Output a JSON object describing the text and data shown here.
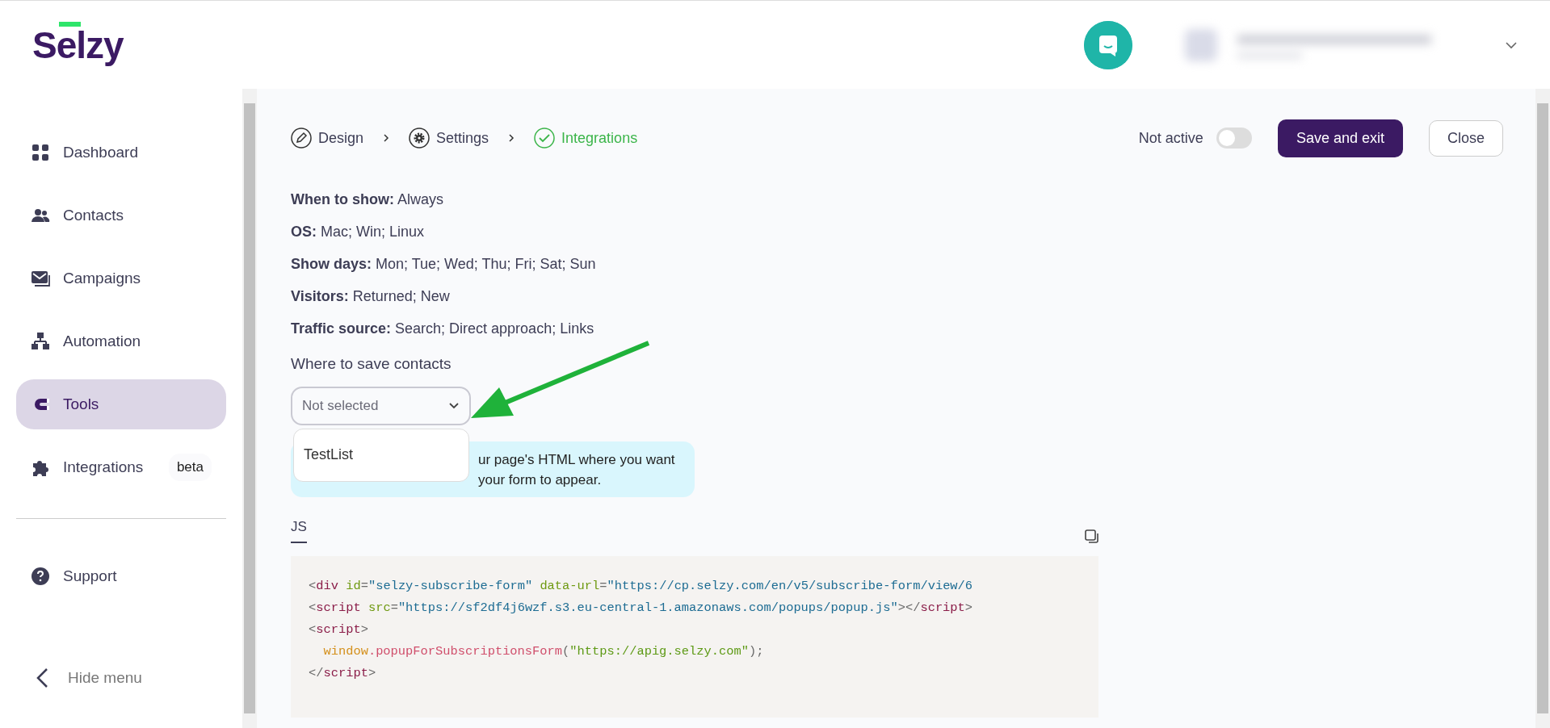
{
  "logo": {
    "text": "Selzy"
  },
  "sidebar": {
    "items": [
      {
        "label": "Dashboard",
        "kind": "grid",
        "selected": false
      },
      {
        "label": "Contacts",
        "kind": "people",
        "selected": false
      },
      {
        "label": "Campaigns",
        "kind": "mail",
        "selected": false
      },
      {
        "label": "Automation",
        "kind": "tree",
        "selected": false
      },
      {
        "label": "Tools",
        "kind": "magnet",
        "selected": true
      },
      {
        "label": "Integrations",
        "kind": "puzzle",
        "selected": false,
        "badge": "beta"
      }
    ],
    "support": {
      "label": "Support"
    },
    "hide_menu": {
      "label": "Hide menu"
    }
  },
  "steps": [
    {
      "label": "Design",
      "kind": "pencil",
      "selected": false
    },
    {
      "label": "Settings",
      "kind": "gear",
      "selected": false
    },
    {
      "label": "Integrations",
      "kind": "check",
      "selected": true
    }
  ],
  "status": {
    "label": "Not active",
    "on": false
  },
  "buttons": {
    "save": "Save and exit",
    "close": "Close"
  },
  "summary": [
    {
      "text": "**When to show:** Always"
    },
    {
      "text": "**OS:** Mac; Win; Linux"
    },
    {
      "text": "**Show days:** Mon; Tue; Wed; Thu; Fri; Sat; Sun"
    },
    {
      "text": "**Visitors:** Returned; New"
    },
    {
      "text": "**Traffic source:** Search; Direct approach; Links"
    }
  ],
  "save_contacts": {
    "label": "Where to save contacts",
    "placeholder": "Not selected",
    "expanded": true,
    "options": [
      {
        "label": "TestList",
        "selected": false
      }
    ]
  },
  "notice": {
    "lines": [
      "ur page's HTML where you want",
      "your form to appear."
    ]
  },
  "code_tabs": [
    {
      "label": "JS",
      "selected": true
    }
  ],
  "code": [
    [
      {
        "kind": "punct",
        "s": "<"
      },
      {
        "kind": "tag",
        "s": "div"
      },
      {
        "kind": "attr",
        "s": " id"
      },
      {
        "kind": "punct",
        "s": "="
      },
      {
        "kind": "string",
        "s": "\"selzy-subscribe-form\""
      },
      {
        "kind": "attr",
        "s": " data-url"
      },
      {
        "kind": "punct",
        "s": "="
      },
      {
        "kind": "string",
        "s": "\"https://cp.selzy.com/en/v5/subscribe-form/view/6"
      }
    ],
    [
      {
        "kind": "punct",
        "s": "<"
      },
      {
        "kind": "tag",
        "s": "script"
      },
      {
        "kind": "attr",
        "s": " src"
      },
      {
        "kind": "punct",
        "s": "="
      },
      {
        "kind": "string",
        "s": "\"https://sf2df4j6wzf.s3.eu-central-1.amazonaws.com/popups/popup.js\""
      },
      {
        "kind": "punct",
        "s": "></"
      },
      {
        "kind": "tag",
        "s": "script"
      },
      {
        "kind": "punct",
        "s": ">"
      }
    ],
    [
      {
        "kind": "punct",
        "s": "<"
      },
      {
        "kind": "tag",
        "s": "script"
      },
      {
        "kind": "punct",
        "s": ">"
      }
    ],
    [
      {
        "kind": "var",
        "s": "  window"
      },
      {
        "kind": "func",
        "s": ".popupForSubscriptionsForm"
      },
      {
        "kind": "punct",
        "s": "("
      },
      {
        "kind": "arg",
        "s": "\"https://apig.selzy.com\""
      },
      {
        "kind": "punct",
        "s": ");"
      }
    ],
    [
      {
        "kind": "punct",
        "s": "</"
      },
      {
        "kind": "tag",
        "s": "script"
      },
      {
        "kind": "punct",
        "s": ">"
      }
    ]
  ]
}
